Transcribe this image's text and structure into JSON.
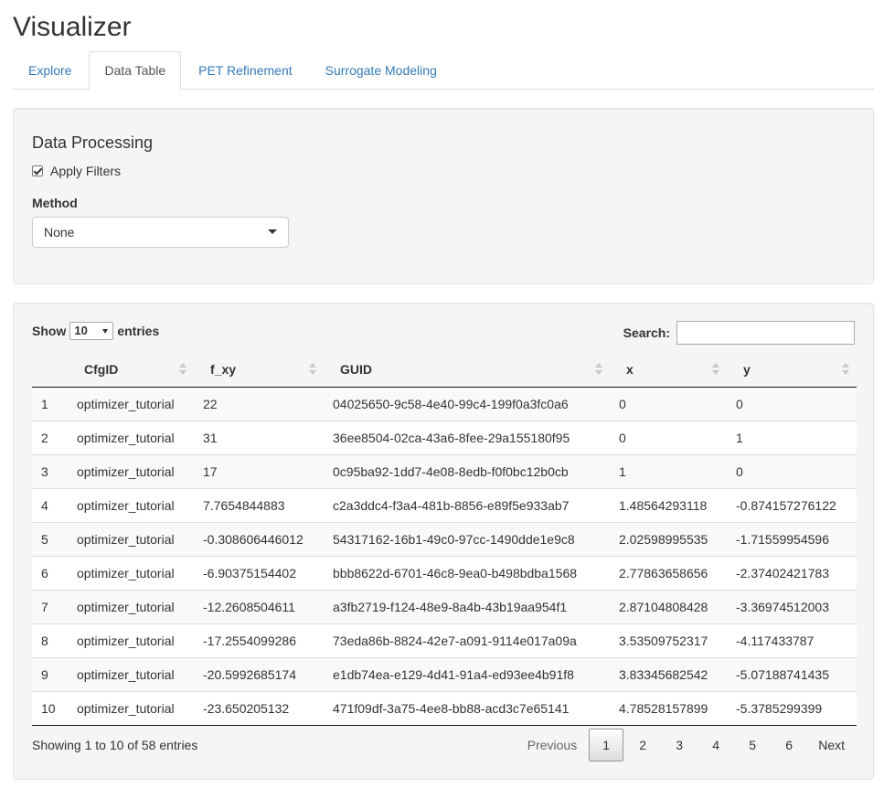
{
  "app": {
    "title": "Visualizer"
  },
  "tabs": [
    {
      "label": "Explore",
      "active": false
    },
    {
      "label": "Data Table",
      "active": true
    },
    {
      "label": "PET Refinement",
      "active": false
    },
    {
      "label": "Surrogate Modeling",
      "active": false
    }
  ],
  "processing": {
    "title": "Data Processing",
    "apply_filters_label": "Apply Filters",
    "apply_filters_checked": true,
    "method_label": "Method",
    "method_value": "None"
  },
  "table": {
    "show_label": "Show",
    "page_length": "10",
    "entries_label": "entries",
    "search_label": "Search:",
    "search_value": "",
    "columns": [
      "",
      "CfgID",
      "f_xy",
      "GUID",
      "x",
      "y"
    ],
    "rows": [
      [
        "1",
        "optimizer_tutorial",
        "22",
        "04025650-9c58-4e40-99c4-199f0a3fc0a6",
        "0",
        "0"
      ],
      [
        "2",
        "optimizer_tutorial",
        "31",
        "36ee8504-02ca-43a6-8fee-29a155180f95",
        "0",
        "1"
      ],
      [
        "3",
        "optimizer_tutorial",
        "17",
        "0c95ba92-1dd7-4e08-8edb-f0f0bc12b0cb",
        "1",
        "0"
      ],
      [
        "4",
        "optimizer_tutorial",
        "7.7654844883",
        "c2a3ddc4-f3a4-481b-8856-e89f5e933ab7",
        "1.48564293118",
        "-0.874157276122"
      ],
      [
        "5",
        "optimizer_tutorial",
        "-0.308606446012",
        "54317162-16b1-49c0-97cc-1490dde1e9c8",
        "2.02598995535",
        "-1.71559954596"
      ],
      [
        "6",
        "optimizer_tutorial",
        "-6.90375154402",
        "bbb8622d-6701-46c8-9ea0-b498bdba1568",
        "2.77863658656",
        "-2.37402421783"
      ],
      [
        "7",
        "optimizer_tutorial",
        "-12.2608504611",
        "a3fb2719-f124-48e9-8a4b-43b19aa954f1",
        "2.87104808428",
        "-3.36974512003"
      ],
      [
        "8",
        "optimizer_tutorial",
        "-17.2554099286",
        "73eda86b-8824-42e7-a091-9114e017a09a",
        "3.53509752317",
        "-4.117433787"
      ],
      [
        "9",
        "optimizer_tutorial",
        "-20.5992685174",
        "e1db74ea-e129-4d41-91a4-ed93ee4b91f8",
        "3.83345682542",
        "-5.07188741435"
      ],
      [
        "10",
        "optimizer_tutorial",
        "-23.650205132",
        "471f09df-3a75-4ee8-bb88-acd3c7e65141",
        "4.78528157899",
        "-5.3785299399"
      ]
    ],
    "info": "Showing 1 to 10 of 58 entries",
    "pager": {
      "previous": "Previous",
      "pages": [
        "1",
        "2",
        "3",
        "4",
        "5",
        "6"
      ],
      "current": "1",
      "next": "Next"
    }
  },
  "colors": {
    "link": "#337ab7",
    "well_bg": "#f5f5f5",
    "striped_row": "#f9f9f9"
  }
}
